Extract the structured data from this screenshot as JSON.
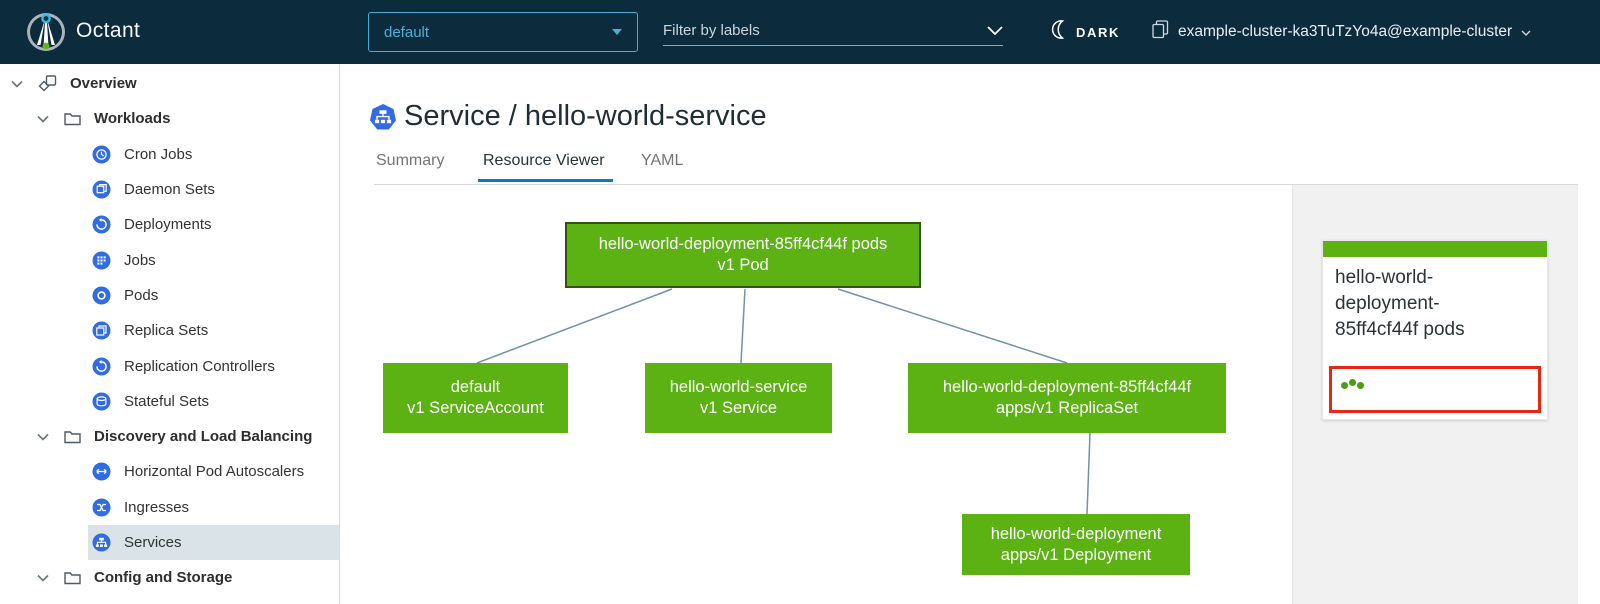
{
  "header": {
    "app_title": "Octant",
    "namespace_selector": {
      "value": "default"
    },
    "filter": {
      "placeholder": "Filter by labels"
    },
    "theme_toggle": {
      "label": "DARK"
    },
    "cluster": {
      "label": "example-cluster-ka3TuTzYo4a@example-cluster"
    }
  },
  "sidebar": {
    "items": [
      {
        "label": "Overview",
        "level": 0,
        "type": "root"
      },
      {
        "label": "Workloads",
        "level": 1,
        "type": "group"
      },
      {
        "label": "Cron Jobs",
        "level": 2
      },
      {
        "label": "Daemon Sets",
        "level": 2
      },
      {
        "label": "Deployments",
        "level": 2
      },
      {
        "label": "Jobs",
        "level": 2
      },
      {
        "label": "Pods",
        "level": 2
      },
      {
        "label": "Replica Sets",
        "level": 2
      },
      {
        "label": "Replication Controllers",
        "level": 2
      },
      {
        "label": "Stateful Sets",
        "level": 2
      },
      {
        "label": "Discovery and Load Balancing",
        "level": 1,
        "type": "group"
      },
      {
        "label": "Horizontal Pod Autoscalers",
        "level": 2
      },
      {
        "label": "Ingresses",
        "level": 2
      },
      {
        "label": "Services",
        "level": 2,
        "selected": true
      },
      {
        "label": "Config and Storage",
        "level": 1,
        "type": "group"
      }
    ]
  },
  "main": {
    "title": "Service / hello-world-service",
    "tabs": [
      {
        "label": "Summary",
        "active": false
      },
      {
        "label": "Resource Viewer",
        "active": true
      },
      {
        "label": "YAML",
        "active": false
      }
    ]
  },
  "graph": {
    "nodes": [
      {
        "id": "pod",
        "line1": "hello-world-deployment-85ff4cf44f pods",
        "line2": "v1 Pod",
        "selected": true
      },
      {
        "id": "serviceaccount",
        "line1": "default",
        "line2": "v1 ServiceAccount",
        "selected": false
      },
      {
        "id": "service",
        "line1": "hello-world-service",
        "line2": "v1 Service",
        "selected": false
      },
      {
        "id": "replicaset",
        "line1": "hello-world-deployment-85ff4cf44f",
        "line2": "apps/v1 ReplicaSet",
        "selected": false
      },
      {
        "id": "deployment",
        "line1": "hello-world-deployment",
        "line2": "apps/v1 Deployment",
        "selected": false
      }
    ],
    "edges": [
      {
        "from": "pod",
        "to": "serviceaccount"
      },
      {
        "from": "pod",
        "to": "service"
      },
      {
        "from": "pod",
        "to": "replicaset"
      },
      {
        "from": "replicaset",
        "to": "deployment"
      }
    ]
  },
  "detail_panel": {
    "card": {
      "title_lines": [
        "hello-world-",
        "deployment-",
        "85ff4cf44f pods"
      ],
      "pod_status_dots": 3
    }
  },
  "colors": {
    "header_bg": "#0c2b3d",
    "accent_blue": "#49afd9",
    "tab_underline": "#0c7bb8",
    "node_green": "#5cb213",
    "selected_node_border": "#33510f",
    "k8s_icon_blue": "#326ce5",
    "status_red_border": "#e62711",
    "panel_bg": "#f1f1f2",
    "sidebar_highlight": "#d9e3e8"
  }
}
